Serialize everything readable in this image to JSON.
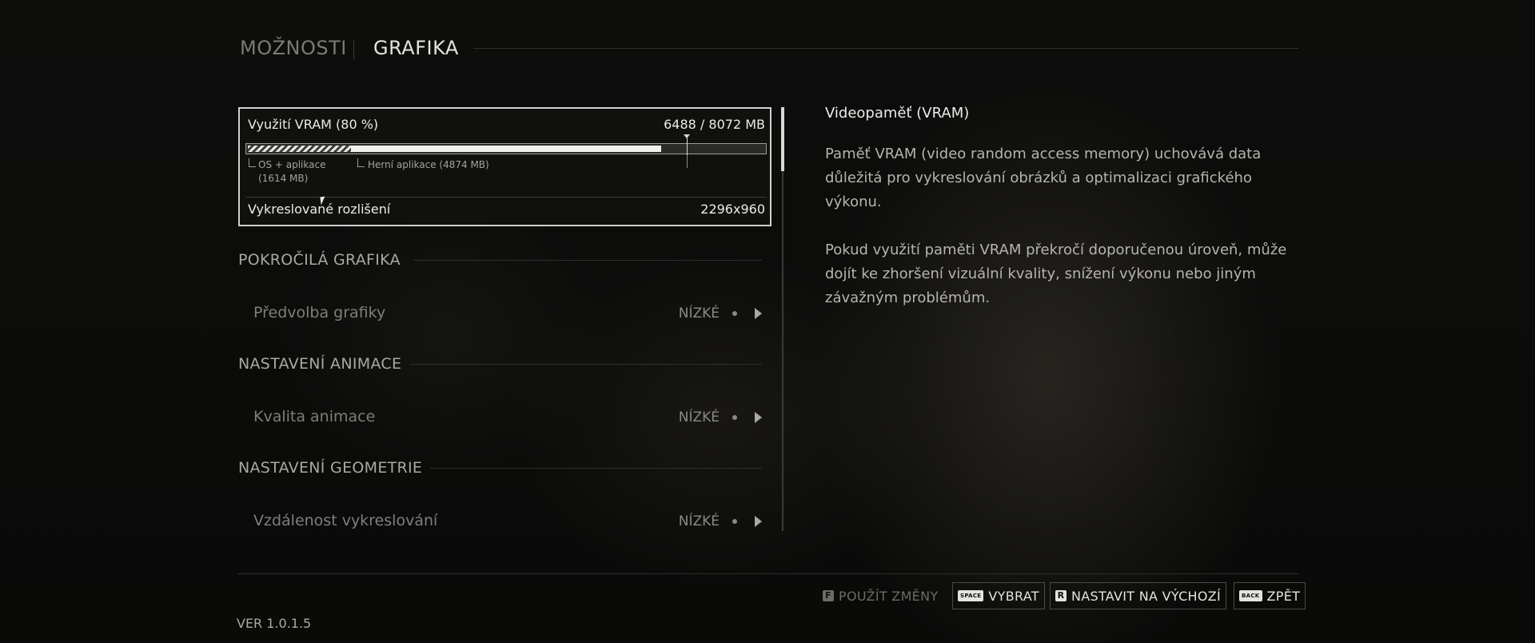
{
  "header": {
    "tabs": [
      {
        "label": "MOŽNOSTI",
        "active": false
      },
      {
        "label": "GRAFIKA",
        "active": true
      }
    ]
  },
  "vram": {
    "title": "Využití VRAM (80 %)",
    "usage_text": "6488 / 8072 MB",
    "used_fraction": 0.8,
    "os_fraction": 0.2,
    "game_fraction": 0.6,
    "recommended_fraction": 0.85,
    "os_legend_line1": "OS + aplikace",
    "os_legend_line2": "(1614 MB)",
    "game_legend": "Herní aplikace (4874 MB)",
    "resolution_label": "Vykreslované rozlišení",
    "resolution_value": "2296x960"
  },
  "sections": [
    {
      "title": "POKROČILÁ GRAFIKA",
      "setting": {
        "label": "Předvolba grafiky",
        "value": "NÍZKÉ"
      }
    },
    {
      "title": "NASTAVENÍ ANIMACE",
      "setting": {
        "label": "Kvalita animace",
        "value": "NÍZKÉ"
      }
    },
    {
      "title": "NASTAVENÍ GEOMETRIE",
      "setting": {
        "label": "Vzdálenost vykreslování",
        "value": "NÍZKÉ"
      }
    }
  ],
  "description": {
    "title": "Videopaměť (VRAM)",
    "paragraph1": "Paměť VRAM (video random access memory) uchovává data důležitá pro vykreslování obrázků a optimalizaci grafického výkonu.",
    "paragraph2": "Pokud využití paměti VRAM překročí doporučenou úroveň, může dojít ke zhoršení vizuální kvality, snížení výkonu nebo jiným závažným problémům."
  },
  "footer": {
    "apply": {
      "key": "F",
      "label": "POUŽÍT ZMĚNY"
    },
    "select": {
      "key": "SPACE",
      "label": "VYBRAT"
    },
    "reset": {
      "key": "R",
      "label": "NASTAVIT NA VÝCHOZÍ"
    },
    "back": {
      "key": "BACK",
      "label": "ZPĚT"
    }
  },
  "version": "VER 1.0.1.5"
}
